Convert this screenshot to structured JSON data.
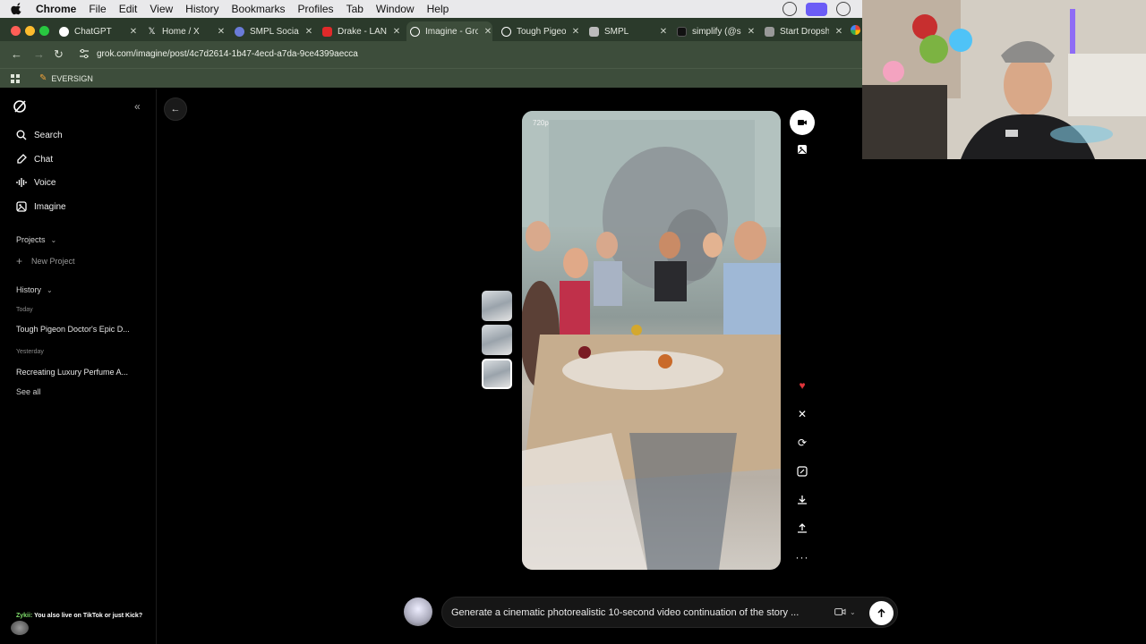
{
  "menubar": {
    "app": "Chrome",
    "items": [
      "File",
      "Edit",
      "View",
      "History",
      "Bookmarks",
      "Profiles",
      "Tab",
      "Window",
      "Help"
    ]
  },
  "tabs": [
    {
      "label": "ChatGPT",
      "favicon_color": "#ffffff"
    },
    {
      "label": "Home / X",
      "favicon_color": "#000000"
    },
    {
      "label": "SMPL Social",
      "favicon_color": "#6a7bd8"
    },
    {
      "label": "Drake - LAND",
      "favicon_color": "#e02a2a"
    },
    {
      "label": "Imagine - Gro",
      "favicon_color": "#ffffff",
      "active": true
    },
    {
      "label": "Tough Pigeon",
      "favicon_color": "#ffffff"
    },
    {
      "label": "SMPL",
      "favicon_color": "#bbbbbb"
    },
    {
      "label": "simplify (@si",
      "favicon_color": "#111111"
    },
    {
      "label": "Start Dropshi",
      "favicon_color": "#999999"
    }
  ],
  "urlbar": {
    "url": "grok.com/imagine/post/4c7d2614-1b47-4ecd-a7da-9ce4399aecca"
  },
  "bookmarks": {
    "items": [
      "EVERSIGN"
    ]
  },
  "sidebar": {
    "nav": [
      {
        "label": "Search",
        "icon": "search-icon"
      },
      {
        "label": "Chat",
        "icon": "chat-icon"
      },
      {
        "label": "Voice",
        "icon": "voice-icon"
      },
      {
        "label": "Imagine",
        "icon": "imagine-icon"
      }
    ],
    "projects_label": "Projects",
    "new_project_label": "New Project",
    "history_label": "History",
    "today_label": "Today",
    "today_items": [
      "Tough Pigeon Doctor's Epic D..."
    ],
    "yesterday_label": "Yesterday",
    "yesterday_items": [
      "Recreating Luxury Perfume A..."
    ],
    "see_all_label": "See all"
  },
  "video": {
    "resolution": "720p"
  },
  "prompt": {
    "text": "Generate a cinematic photorealistic 10-second video continuation of the story ..."
  },
  "chat_overlay": {
    "user": "Zykii:",
    "message": "You also live on TikTok or just Kick?"
  },
  "colors": {
    "tab_bar": "#2b3a2b",
    "toolbar": "#3d4d3b",
    "like": "#e0353b",
    "accent_purple": "#6b5cf6"
  }
}
